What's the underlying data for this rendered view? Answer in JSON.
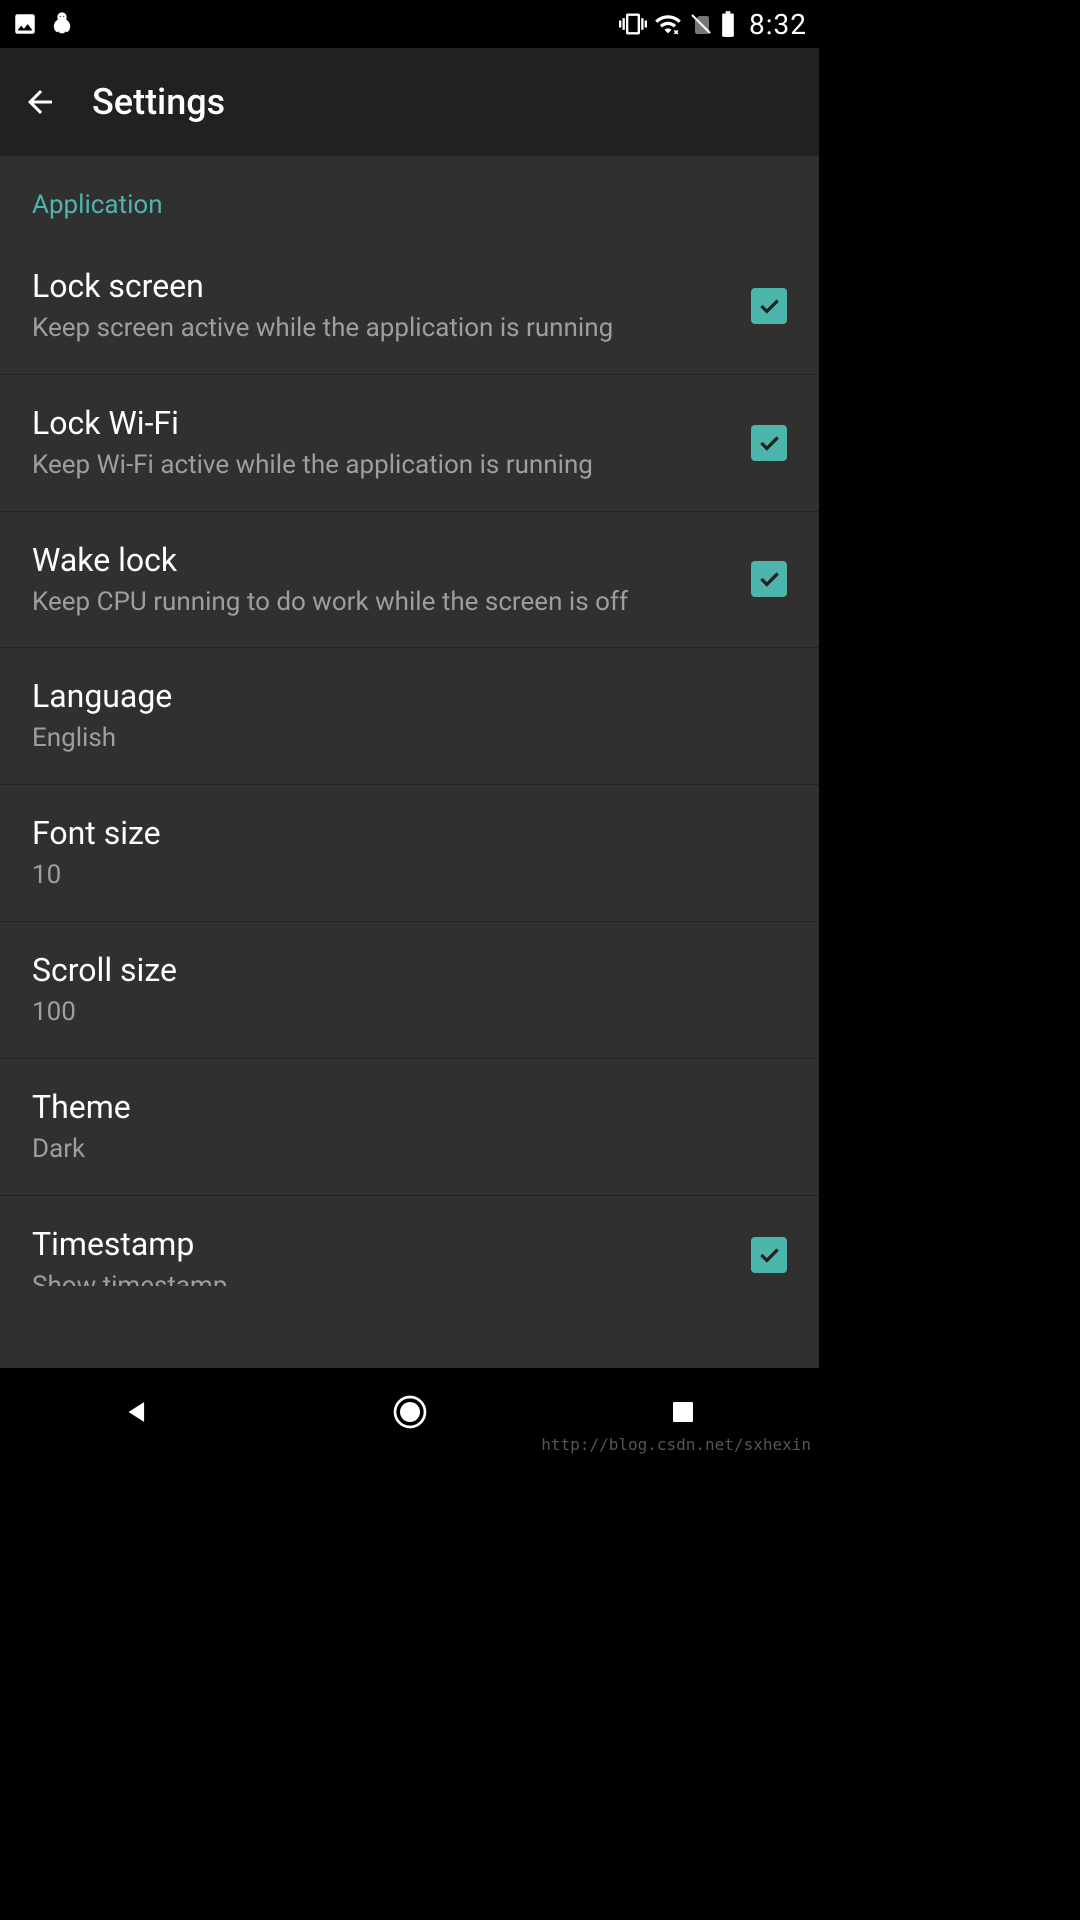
{
  "status_bar": {
    "time": "8:32"
  },
  "app_bar": {
    "title": "Settings"
  },
  "section": {
    "application": "Application"
  },
  "prefs": {
    "lock_screen": {
      "title": "Lock screen",
      "sub": "Keep screen active while the application is running",
      "checked": true
    },
    "lock_wifi": {
      "title": "Lock Wi-Fi",
      "sub": "Keep Wi-Fi active while the application is running",
      "checked": true
    },
    "wake_lock": {
      "title": "Wake lock",
      "sub": "Keep CPU running to do work while the screen is off",
      "checked": true
    },
    "language": {
      "title": "Language",
      "sub": "English"
    },
    "font_size": {
      "title": "Font size",
      "sub": "10"
    },
    "scroll_size": {
      "title": "Scroll size",
      "sub": "100"
    },
    "theme": {
      "title": "Theme",
      "sub": "Dark"
    },
    "timestamp": {
      "title": "Timestamp",
      "sub": "Show timestamp",
      "checked": true
    }
  },
  "watermark": "http://blog.csdn.net/sxhexin"
}
